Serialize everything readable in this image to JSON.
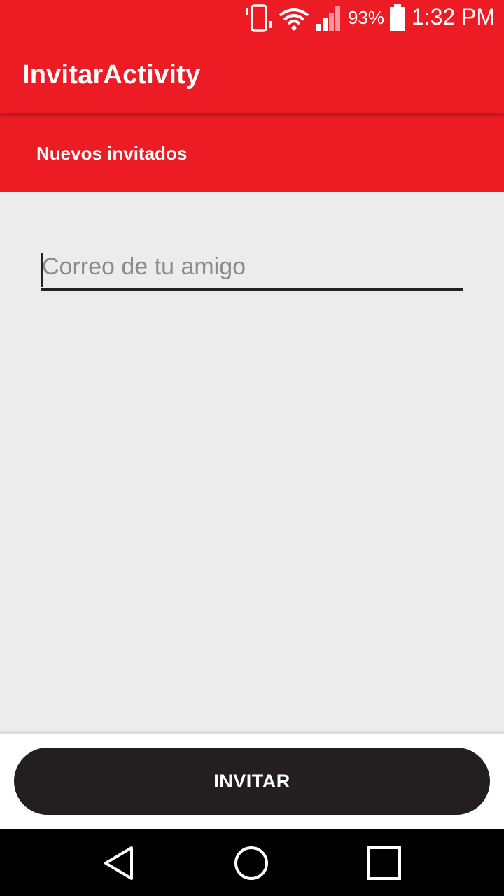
{
  "status_bar": {
    "battery_percent": "93%",
    "time": "1:32 PM",
    "icons": [
      "vibrate-icon",
      "wifi-icon",
      "signal-icon",
      "battery-icon"
    ]
  },
  "app_bar": {
    "title": "InvitarActivity"
  },
  "tab": {
    "label": "Nuevos invitados"
  },
  "form": {
    "email_placeholder": "Correo de tu amigo",
    "email_value": ""
  },
  "actions": {
    "invite_label": "INVITAR"
  },
  "nav_bar": {
    "icons": [
      "back-icon",
      "home-icon",
      "recents-icon"
    ]
  },
  "colors": {
    "primary": "#ed1c24",
    "background": "#ececec",
    "button": "#231f20",
    "text_on_primary": "#ffffff"
  }
}
